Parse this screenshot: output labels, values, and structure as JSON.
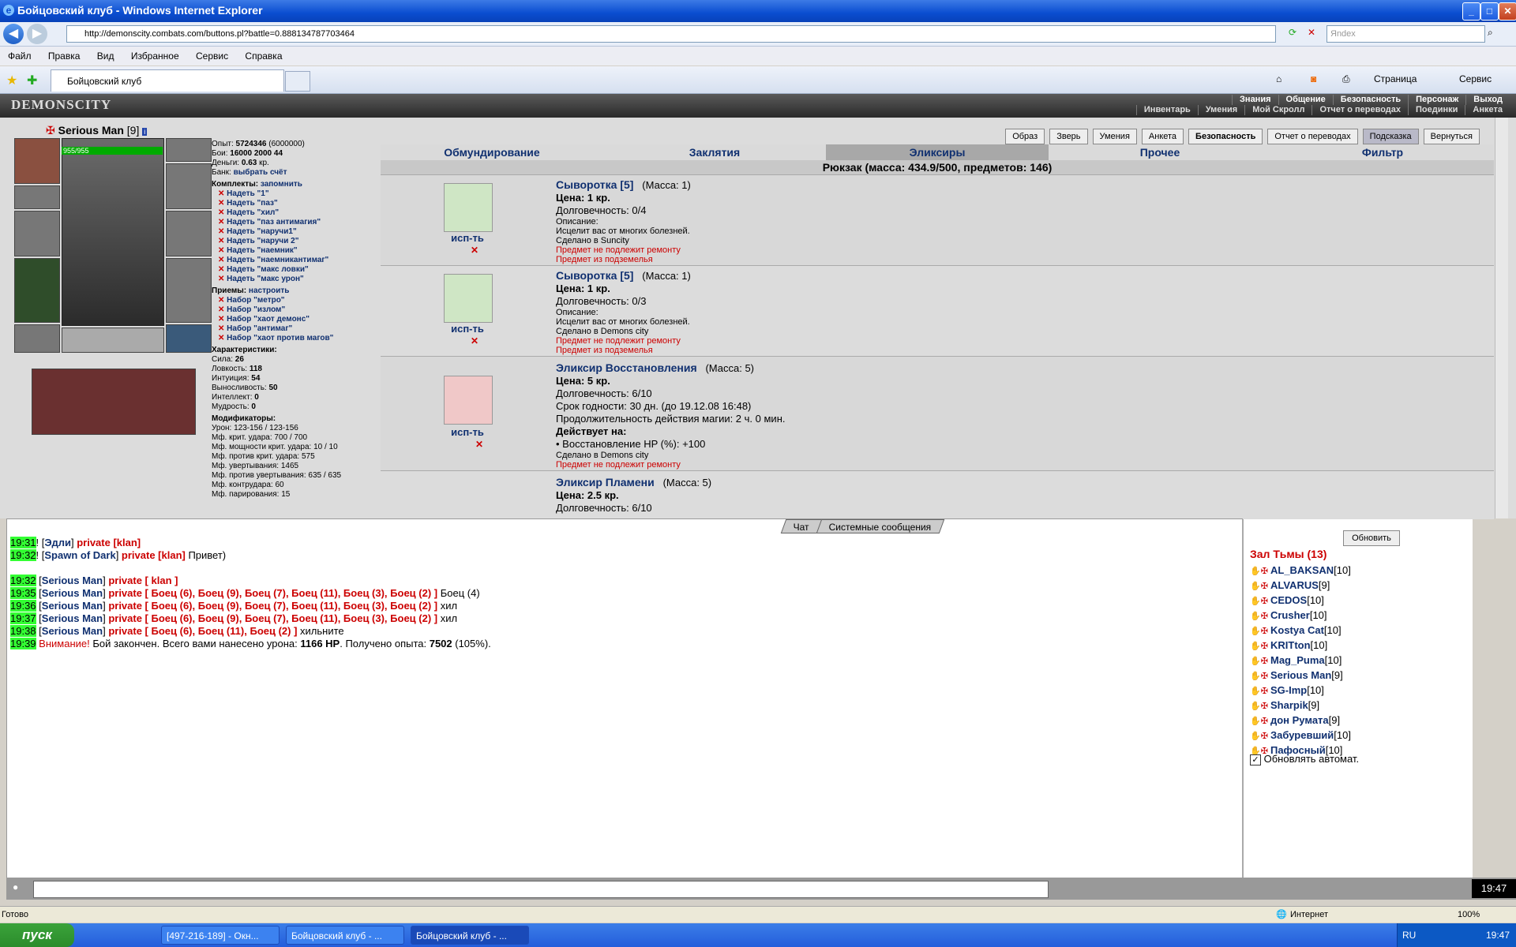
{
  "window": {
    "title": "Бойцовский клуб - Windows Internet Explorer",
    "controls": [
      "minimize-icon",
      "maximize-icon",
      "close-icon"
    ]
  },
  "browser": {
    "url": "http://demonscity.combats.com/buttons.pl?battle=0.888134787703464",
    "search_placeholder": "Яndex",
    "menu": [
      "Файл",
      "Правка",
      "Вид",
      "Избранное",
      "Сервис",
      "Справка"
    ],
    "tab_title": "Бойцовский клуб",
    "toolbar_right": [
      "Страница",
      "Сервис"
    ],
    "status_left": "Готово",
    "status_zone": "Интернет",
    "zoom": "100%"
  },
  "game_header": {
    "logo": "DEMONSCITY",
    "nav_row1": [
      "Знания",
      "Общение",
      "Безопасность",
      "Персонаж",
      "Выход"
    ],
    "nav_row2": [
      "Инвентарь",
      "Умения",
      "Мой Скролл",
      "Отчет о переводах",
      "Поединки",
      "Анкета"
    ]
  },
  "character": {
    "name": "Serious Man",
    "level": "[9]",
    "hp": "955/955",
    "stats": {
      "exp_label": "Опыт:",
      "exp": "5724346",
      "exp_next": "(6000000)",
      "battles_label": "Бои:",
      "wins": "16000",
      "losses": "2000",
      "draws": "44",
      "money_label": "Деньги:",
      "money": "0.63",
      "money_unit": "кр.",
      "bank_label": "Банк:",
      "bank_link": "выбрать счёт"
    },
    "sets_title": "Комплекты:",
    "sets_remember": "запомнить",
    "sets": [
      "Надеть \"1\"",
      "Надеть \"паз\"",
      "Надеть \"хил\"",
      "Надеть \"паз антимагия\"",
      "Надеть \"наручи1\"",
      "Надеть \"наручи 2\"",
      "Надеть \"наемник\"",
      "Надеть \"наемникантимаг\"",
      "Надеть \"макс ловки\"",
      "Надеть \"макс урон\""
    ],
    "tricks_title": "Приемы:",
    "tricks_setup": "настроить",
    "tricks": [
      "Набор \"метро\"",
      "Набор \"излом\"",
      "Набор \"хаот демонс\"",
      "Набор \"антимаг\"",
      "Набор \"хаот против магов\""
    ],
    "attrs_title": "Характеристики:",
    "attrs": [
      {
        "label": "Сила:",
        "value": "26"
      },
      {
        "label": "Ловкость:",
        "value": "118"
      },
      {
        "label": "Интуиция:",
        "value": "54"
      },
      {
        "label": "Выносливость:",
        "value": "50"
      },
      {
        "label": "Интеллект:",
        "value": "0"
      },
      {
        "label": "Мудрость:",
        "value": "0"
      }
    ],
    "mods_title": "Модификаторы:",
    "mods": [
      "Урон: 123-156 / 123-156",
      "Мф. крит. удара: 700 / 700",
      "Мф. мощности крит. удара: 10 / 10",
      "Мф. против крит. удара: 575",
      "Мф. увертывания: 1465",
      "Мф. против увертывания: 635 / 635",
      "Мф. контрудара: 60",
      "Мф. парирования: 15"
    ]
  },
  "top_buttons": [
    "Образ",
    "Зверь",
    "Умения",
    "Анкета",
    "Безопасность",
    "Отчет о переводах",
    "Подсказка",
    "Вернуться"
  ],
  "inventory_tabs": [
    "Обмундирование",
    "Заклятия",
    "Эликсиры",
    "Прочее",
    "Фильтр"
  ],
  "backpack": "Рюкзак (масса: 434.9/500, предметов: 146)",
  "items": [
    {
      "name": "Сыворотка [5]",
      "mass": "(Масса: 1)",
      "use": "исп-ть",
      "price": "Цена: 1 кр.",
      "durability": "Долговечность: 0/4",
      "desc_label": "Описание:",
      "desc": "Исцелит вас от многих болезней.",
      "made": "Сделано в Suncity",
      "warn1": "Предмет не подлежит ремонту",
      "warn2": "Предмет из подземелья"
    },
    {
      "name": "Сыворотка [5]",
      "mass": "(Масса: 1)",
      "use": "исп-ть",
      "price": "Цена: 1 кр.",
      "durability": "Долговечность: 0/3",
      "desc_label": "Описание:",
      "desc": "Исцелит вас от многих болезней.",
      "made": "Сделано в Demons city",
      "warn1": "Предмет не подлежит ремонту",
      "warn2": "Предмет из подземелья"
    },
    {
      "name": "Эликсир Восстановления",
      "mass": "(Масса: 5)",
      "use": "исп-ть",
      "price": "Цена: 5 кр.",
      "durability": "Долговечность: 6/10",
      "expiry": "Срок годности: 30 дн. (до 19.12.08 16:48)",
      "duration": "Продолжительность действия магии: 2 ч. 0 мин.",
      "acts_label": "Действует на:",
      "acts": "• Восстановление HP (%): +100",
      "made": "Сделано в Demons city",
      "warn1": "Предмет не подлежит ремонту"
    },
    {
      "name": "Эликсир Пламени",
      "mass": "(Масса: 5)",
      "price": "Цена: 2.5 кр.",
      "durability": "Долговечность: 6/10"
    }
  ],
  "chat": {
    "tabs": [
      "Чат",
      "Системные сообщения"
    ],
    "lines": [
      {
        "time": "19:31",
        "pre": "! [",
        "name": "Эдли",
        "mid": "] ",
        "priv": "private [klan]",
        "text": ""
      },
      {
        "time": "19:32",
        "pre": "! [",
        "name": "Spawn of Dark",
        "mid": "] ",
        "priv": "private [klan]",
        "text": " Привет)"
      },
      {
        "time": "19:32",
        "pre": " [",
        "name": "Serious Man",
        "mid": "] ",
        "priv": "private [ klan ]",
        "text": ""
      },
      {
        "time": "19:35",
        "pre": " [",
        "name": "Serious Man",
        "mid": "] ",
        "priv": "private [ Боец (6), Боец (9), Боец (7), Боец (11), Боец (3), Боец (2) ]",
        "text": " Боец (4)"
      },
      {
        "time": "19:36",
        "pre": " [",
        "name": "Serious Man",
        "mid": "] ",
        "priv": "private [ Боец (6), Боец (9), Боец (7), Боец (11), Боец (3), Боец (2) ]",
        "text": " хил"
      },
      {
        "time": "19:37",
        "pre": " [",
        "name": "Serious Man",
        "mid": "] ",
        "priv": "private [ Боец (6), Боец (9), Боец (7), Боец (11), Боец (3), Боец (2) ]",
        "text": " хил"
      },
      {
        "time": "19:38",
        "pre": " [",
        "name": "Serious Man",
        "mid": "] ",
        "priv": "private [ Боец (6), Боец (11), Боец (2) ]",
        "text": " хильните"
      }
    ],
    "system": {
      "time": "19:39",
      "warn": "Внимание!",
      "text1": " Бой закончен. Всего вами нанесено урона: ",
      "dmg": "1166 HP",
      "text2": ". Получено опыта: ",
      "exp": "7502",
      "text3": " (105%)."
    }
  },
  "room": {
    "refresh": "Обновить",
    "title": "Зал Тьмы (13)",
    "users": [
      {
        "name": "AL_BAKSAN",
        "lvl": "[10]"
      },
      {
        "name": "ALVARUS",
        "lvl": "[9]"
      },
      {
        "name": "CEDOS",
        "lvl": "[10]"
      },
      {
        "name": "Crusher",
        "lvl": "[10]"
      },
      {
        "name": "Kostya Cat",
        "lvl": "[10]"
      },
      {
        "name": "KRITton",
        "lvl": "[10]"
      },
      {
        "name": "Mag_Puma",
        "lvl": "[10]"
      },
      {
        "name": "Serious Man",
        "lvl": "[9]"
      },
      {
        "name": "SG-Imp",
        "lvl": "[10]"
      },
      {
        "name": "Sharpik",
        "lvl": "[9]"
      },
      {
        "name": "дон Румата",
        "lvl": "[9]"
      },
      {
        "name": "Забуревший",
        "lvl": "[10]"
      },
      {
        "name": "Пафосный",
        "lvl": "[10]"
      }
    ],
    "auto_refresh": "Обновлять автомат."
  },
  "clock": "19:47",
  "taskbar": {
    "start": "пуск",
    "tasks": [
      "[497-216-189] - Окн...",
      "Бойцовский клуб - ...",
      "Бойцовский клуб - ..."
    ],
    "lang": "RU",
    "time": "19:47"
  },
  "colors": {
    "link": "#103070",
    "private": "#cc0000",
    "time_bg": "#33ff33"
  }
}
